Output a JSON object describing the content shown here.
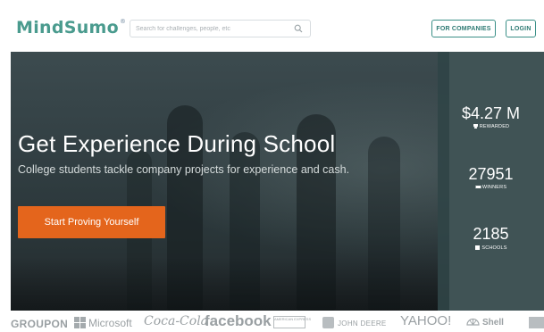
{
  "header": {
    "logo_text": "MindSumo",
    "logo_mark": "®",
    "search_placeholder": "Search for challenges, people, etc",
    "companies_label": "FOR COMPANIES",
    "login_label": "LOGIN"
  },
  "hero": {
    "headline": "Get Experience During School",
    "subheadline": "College students tackle company projects for experience and cash.",
    "cta_label": "Start Proving Yourself"
  },
  "stats": [
    {
      "value": "$4.27 M",
      "label": "REWARDED",
      "icon": "trophy-icon"
    },
    {
      "value": "27951",
      "label": "WINNERS",
      "icon": "ribbon-icon"
    },
    {
      "value": "2185",
      "label": "SCHOOLS",
      "icon": "building-icon"
    }
  ],
  "partners": {
    "groupon": "GROUPON",
    "microsoft": "Microsoft",
    "cocacola": "Coca-Cola",
    "facebook": "facebook",
    "amex": "AMERICAN EXPRESS",
    "deere": "JOHN DEERE",
    "yahoo": "YAHOO!",
    "shell": "Shell"
  },
  "colors": {
    "brand_teal": "#4a9b8e",
    "cta_orange": "#e4651c",
    "stats_panel": "#304446"
  }
}
